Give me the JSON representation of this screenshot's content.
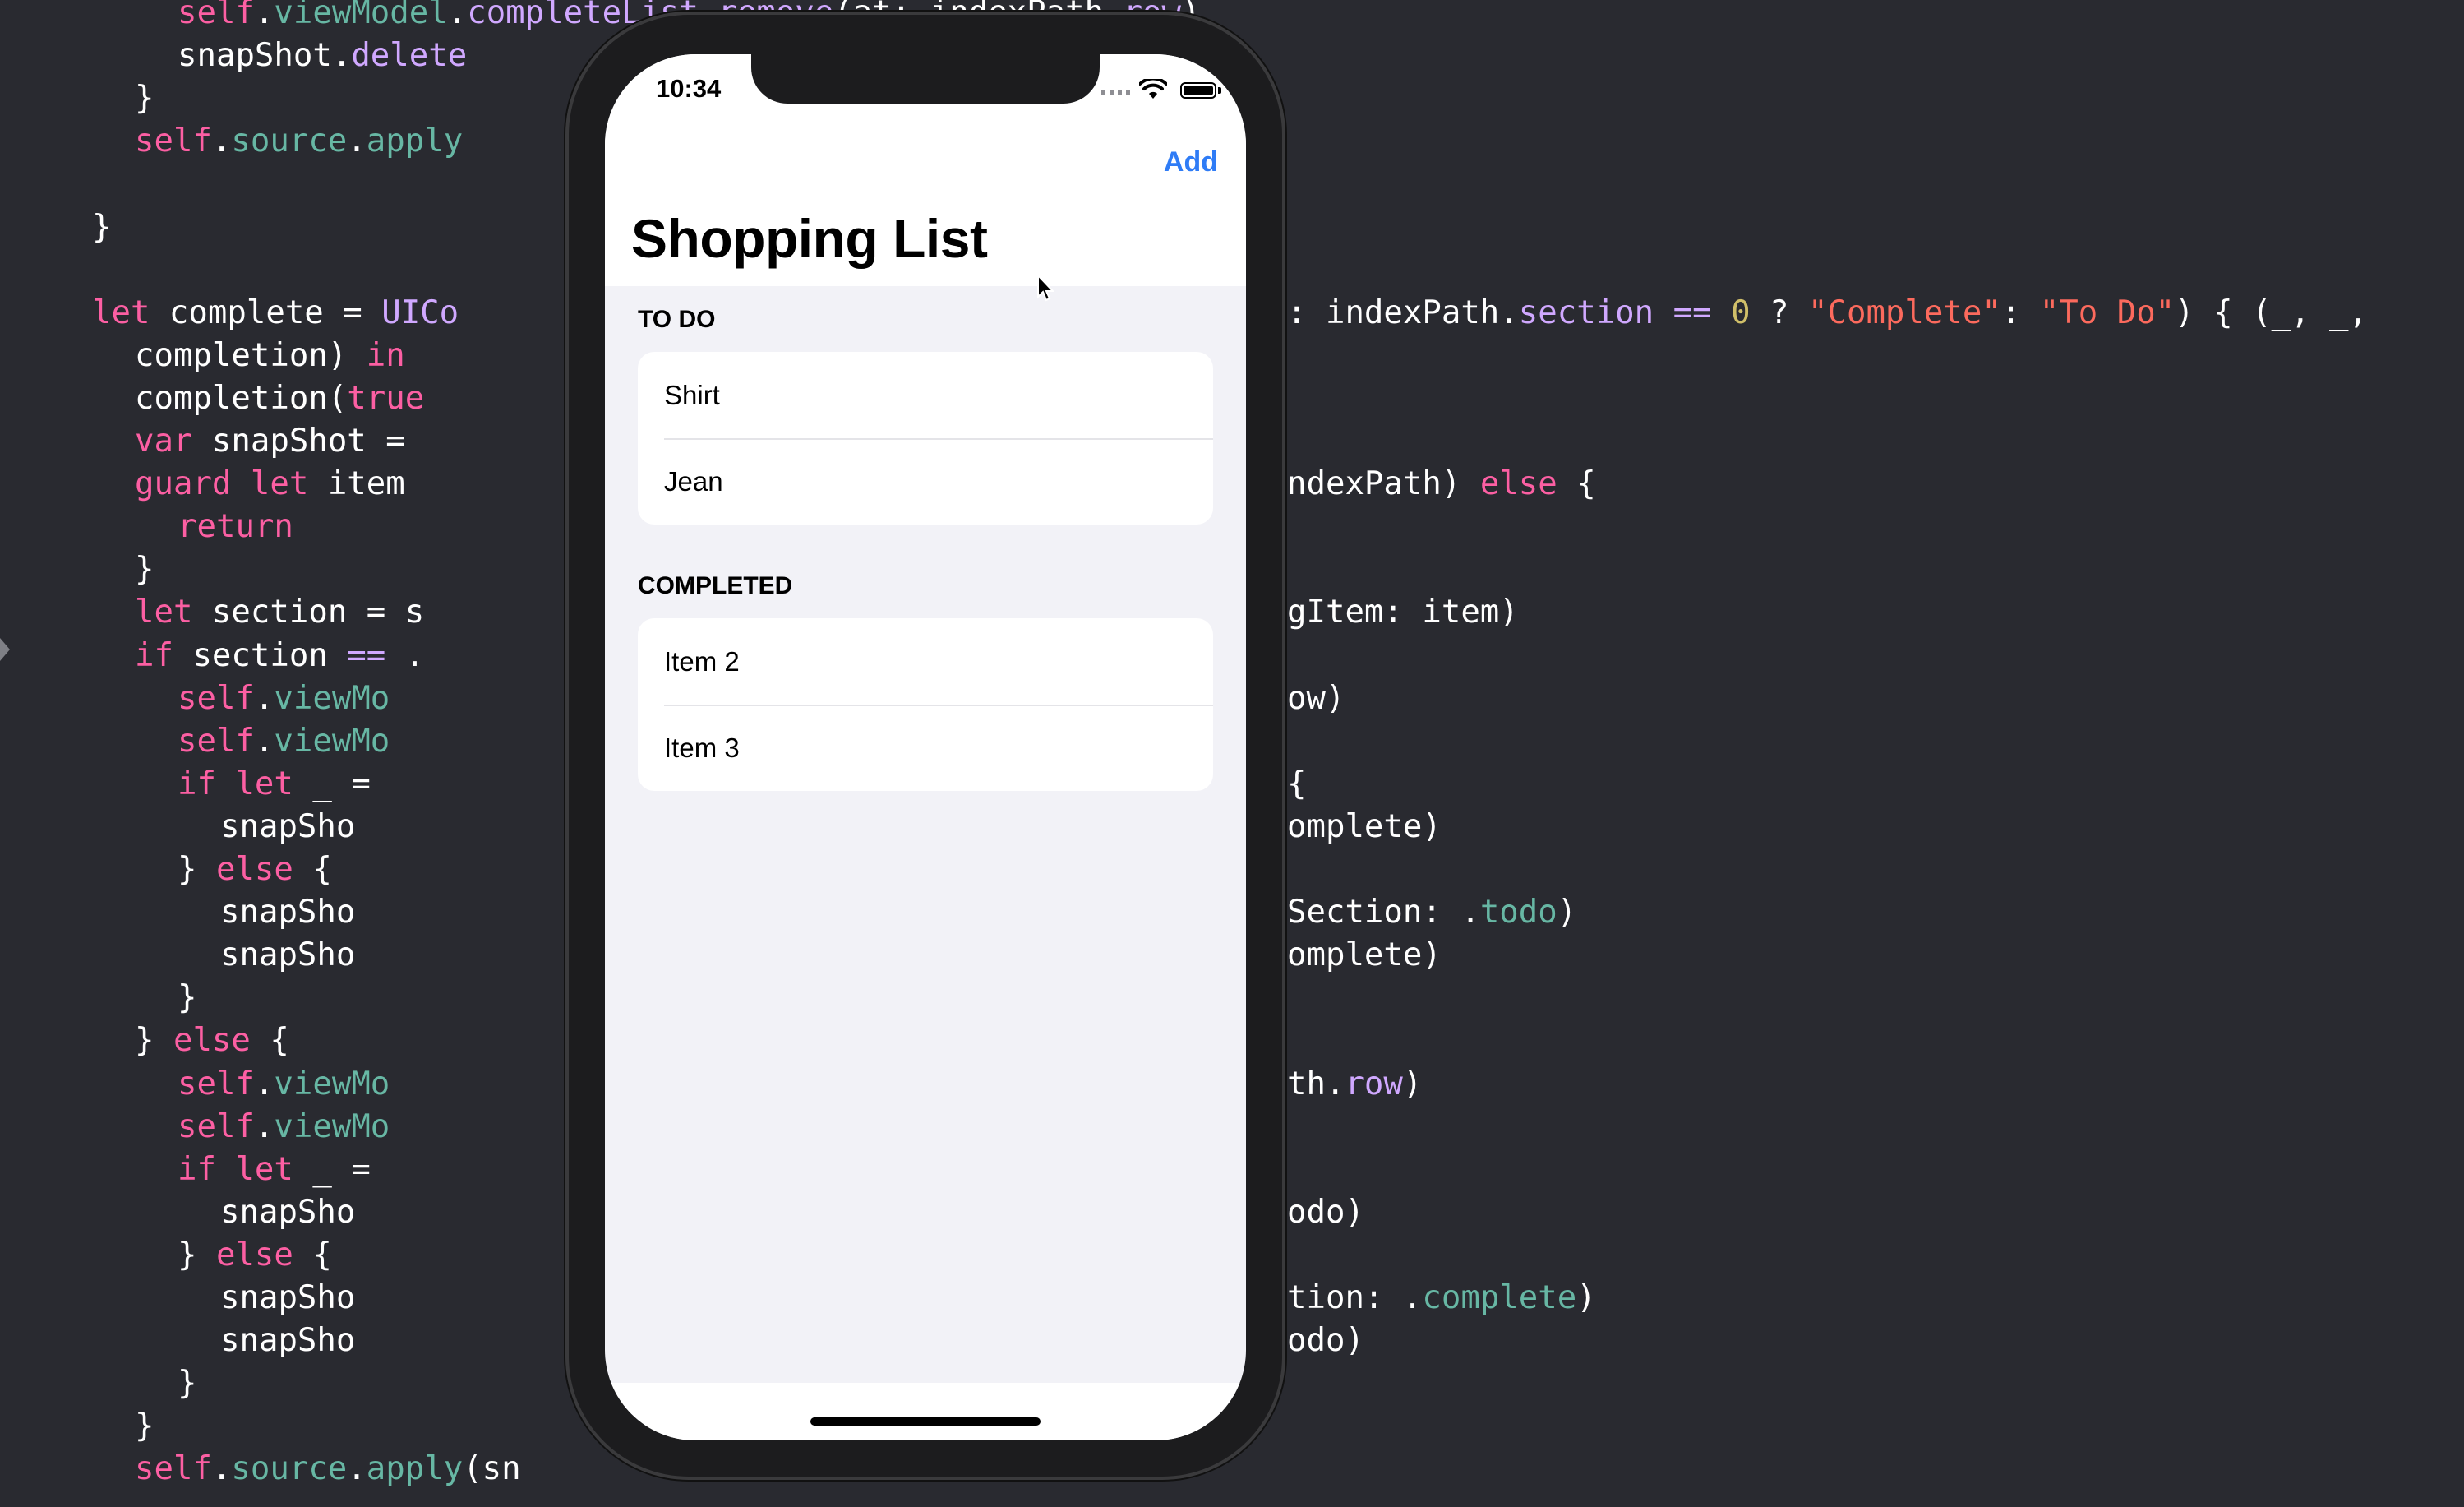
{
  "editor": {
    "lines": [
      {
        "indent": 6,
        "text": "self.viewModel.completeList.remove(at: indexPath.row)"
      },
      {
        "indent": 6,
        "text": "snapShot.delete"
      },
      {
        "indent": 5,
        "text": "}"
      },
      {
        "indent": 5,
        "text": "self.source.apply"
      },
      {
        "indent": 0,
        "text": ""
      },
      {
        "indent": 4,
        "text": "}"
      },
      {
        "indent": 0,
        "text": ""
      },
      {
        "indent": 4,
        "text": "let complete = UICo"
      },
      {
        "indent": 5,
        "text": "completion) in"
      },
      {
        "indent": 5,
        "text": "completion(true"
      },
      {
        "indent": 5,
        "text": "var snapShot ="
      },
      {
        "indent": 5,
        "text": "guard let item"
      },
      {
        "indent": 6,
        "text": "return"
      },
      {
        "indent": 5,
        "text": "}"
      },
      {
        "indent": 5,
        "text": "let section = s"
      },
      {
        "indent": 5,
        "text": "if section == ."
      },
      {
        "indent": 6,
        "text": "self.viewMo"
      },
      {
        "indent": 6,
        "text": "self.viewMo"
      },
      {
        "indent": 6,
        "text": "if let _ ="
      },
      {
        "indent": 7,
        "text": "snapSho"
      },
      {
        "indent": 6,
        "text": "} else {"
      },
      {
        "indent": 7,
        "text": "snapSho"
      },
      {
        "indent": 7,
        "text": "snapSho"
      },
      {
        "indent": 6,
        "text": "}"
      },
      {
        "indent": 5,
        "text": "} else {"
      },
      {
        "indent": 6,
        "text": "self.viewMo"
      },
      {
        "indent": 6,
        "text": "self.viewMo"
      },
      {
        "indent": 6,
        "text": "if let _ ="
      },
      {
        "indent": 7,
        "text": "snapSho"
      },
      {
        "indent": 6,
        "text": "} else {"
      },
      {
        "indent": 7,
        "text": "snapSho"
      },
      {
        "indent": 7,
        "text": "snapSho"
      },
      {
        "indent": 6,
        "text": "}"
      },
      {
        "indent": 5,
        "text": "}"
      },
      {
        "indent": 5,
        "text": "self.source.apply(sn"
      }
    ],
    "right_fragments": [
      {
        "line": 7,
        "text": ": indexPath.section == 0 ? \"Complete\": \"To Do\") { (_, _,"
      },
      {
        "line": 11,
        "text": "ndexPath) else {"
      },
      {
        "line": 14,
        "text": "gItem: item)"
      },
      {
        "line": 16,
        "text": "ow)"
      },
      {
        "line": 18,
        "text": "{"
      },
      {
        "line": 19,
        "text": "omplete)"
      },
      {
        "line": 21,
        "text": "Section: .todo)"
      },
      {
        "line": 22,
        "text": "omplete)"
      },
      {
        "line": 25,
        "text": "th.row)"
      },
      {
        "line": 28,
        "text": "odo)"
      },
      {
        "line": 30,
        "text": "tion: .complete)"
      },
      {
        "line": 31,
        "text": "odo)"
      }
    ]
  },
  "status_bar": {
    "time": "10:34"
  },
  "nav": {
    "add_label": "Add",
    "title": "Shopping List"
  },
  "sections": [
    {
      "header": "TO DO",
      "items": [
        "Shirt",
        "Jean"
      ]
    },
    {
      "header": "COMPLETED",
      "items": [
        "Item 2",
        "Item 3"
      ]
    }
  ],
  "colors": {
    "editor_bg": "#292a30",
    "keyword": "#fc5fa3",
    "type": "#d0a8ff",
    "function": "#67b7a4",
    "string": "#fc6a5d",
    "number": "#d0bf69",
    "accent": "#2f7cf6",
    "grouped_bg": "#f2f2f7"
  }
}
